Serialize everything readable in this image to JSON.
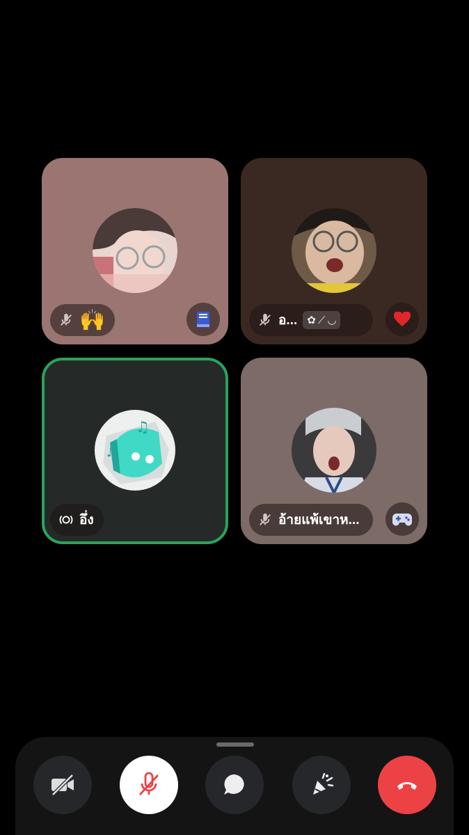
{
  "participants": [
    {
      "name": "",
      "status_emoji": "🙌",
      "badge_icon": "book-icon",
      "bg": "#9a7571",
      "muted": true
    },
    {
      "name": "อ...",
      "tags": [
        "✿",
        "⟋",
        "◡"
      ],
      "badge_icon": "heart-icon",
      "bg": "#3a2923",
      "muted": true
    },
    {
      "name": "อึ่ง",
      "badge_icon": "",
      "bg": "#252a29",
      "speaking": true,
      "speaking_color": "#2aa35a",
      "muted": false
    },
    {
      "name": "อ้ายแพ้เขาห...",
      "badge_icon": "gamepad-icon",
      "bg": "#7d6b68",
      "muted": true
    }
  ],
  "controls": {
    "camera": {
      "icon": "camera-off-icon",
      "state": "off"
    },
    "mic": {
      "icon": "mic-off-icon",
      "state": "muted"
    },
    "chat": {
      "icon": "chat-bubble-icon"
    },
    "activities": {
      "icon": "rocket-party-icon"
    },
    "end_call": {
      "icon": "hangup-icon",
      "color": "#ed4245"
    }
  }
}
